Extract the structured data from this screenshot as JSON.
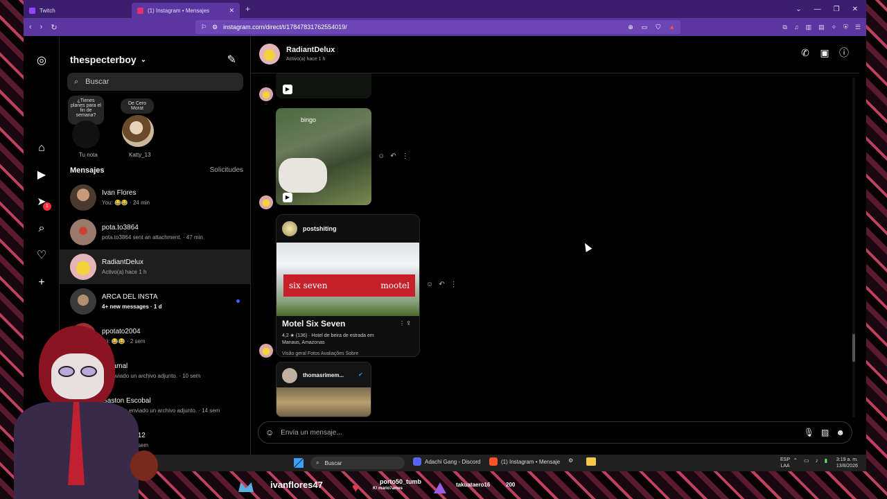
{
  "browser": {
    "tabs": [
      {
        "label": "Twitch",
        "color": "#9146ff"
      },
      {
        "label": "(1) Instagram • Mensajes",
        "color": "#e1306c"
      }
    ],
    "url": "instagram.com/direct/t/17847831762554019/"
  },
  "inbox": {
    "username": "thespecterboy",
    "search_placeholder": "Buscar",
    "notes": [
      {
        "bubble": "¿Tienes planes para el fin de semana?",
        "name": "Tu nota"
      },
      {
        "bubble": "De Cero Morat",
        "name": "Katty_13"
      }
    ],
    "messages_title": "Mensajes",
    "requests_label": "Solicitudes",
    "conversations": [
      {
        "name": "Ivan Flores",
        "sub": "You: 😂😂 · 24 min",
        "bold": false
      },
      {
        "name": "pota.to3864",
        "sub": "pota.to3864 sent an attachment. · 47 min",
        "bold": false
      },
      {
        "name": "RadiantDelux",
        "sub": "Activo(a) hace 1 h",
        "bold": false,
        "selected": true
      },
      {
        "name": "ARCA DEL INSTA",
        "sub": "4+ new messages · 1 d",
        "bold": true,
        "unread": true
      },
      {
        "name": "ppotato2004",
        "sub": "Tú: 😂😂 · 2 sem",
        "bold": false
      },
      {
        "name": "Retamal",
        "sub": "ha enviado un archivo adjunto. · 10 sem",
        "bold": false
      },
      {
        "name": "Gaston Escobal",
        "sub": "Gaston ha enviado un archivo adjunto. · 14 sem",
        "bold": false
      },
      {
        "name": "tinad_papel12",
        "sub": "Tú: 😂😂 · 18 sem",
        "bold": false
      }
    ]
  },
  "thread": {
    "name": "RadiantDelux",
    "status": "Activo(a) hace 1 h",
    "reel_overlay_text": "bingo",
    "post": {
      "author": "postshiting",
      "sign_left": "six seven",
      "sign_right": "mootel",
      "place": "Motel Six Seven",
      "details": "4,2 ★ (136) · Hotel de beira de estrada em Manaus, Amazonas",
      "chips": "Visão geral   Fotos   Avaliações   Sobre"
    },
    "share_author": "thomasrimem...",
    "composer_placeholder": "Envía un mensaje..."
  },
  "taskbar": {
    "search": "Buscar",
    "apps": [
      "Adachi Gang - Discord",
      "(1) Instagram • Mensaje"
    ],
    "lang": [
      "ESP",
      "LAA"
    ],
    "time": "3:19 a. m.",
    "date": "13/8/2026"
  },
  "overlay": {
    "follower": "ivanflores47",
    "sub_name": "porto50_tumb",
    "sub_sub": "K! mario7ames",
    "bits_user": "takuataero16",
    "bits_amount": "200"
  }
}
